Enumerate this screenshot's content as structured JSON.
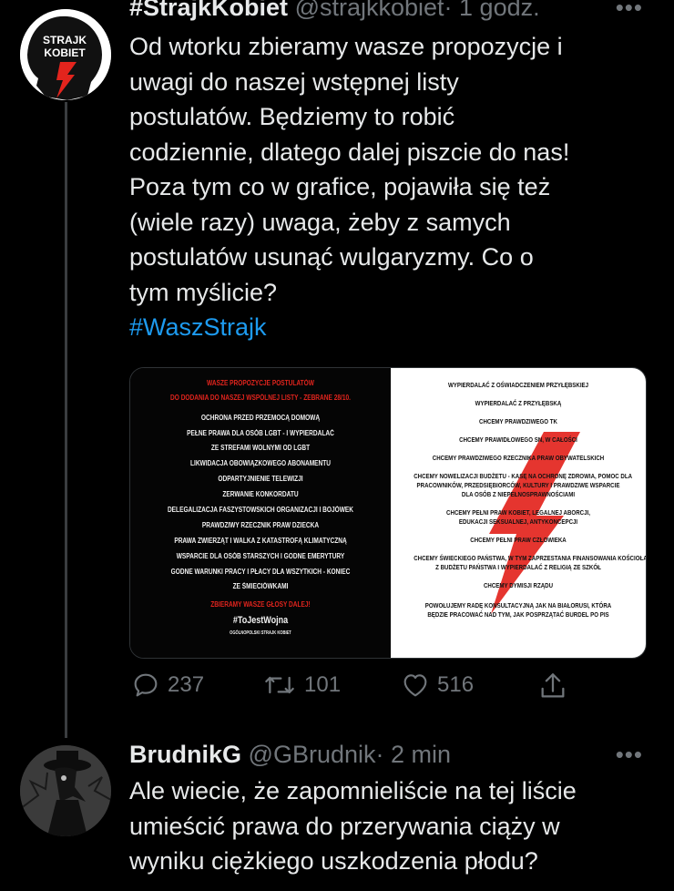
{
  "tweet1": {
    "name": "#StrajkKobiet",
    "handle": "@strajkkobiet",
    "time": "· 1 godz.",
    "more": "•••",
    "avatar_text": [
      "STRAJK",
      "KOBIET"
    ],
    "text_lines": [
      "Od wtorku zbieramy wasze propozycje i",
      "uwagi do naszej wstępnej listy",
      "postulatów. Będziemy to robić",
      "codziennie, dlatego dalej piszcie do nas!",
      "Poza tym co w grafice, pojawiła się też",
      "(wiele razy) uwaga, żeby z samych",
      "postulatów usunąć wulgaryzmy. Co o",
      "tym myślicie?"
    ],
    "hashtag": "#WaszStrajk",
    "media": {
      "left": [
        {
          "t": "WASZE PROPOZYCJE POSTULATÓW",
          "red": true
        },
        {
          "t": "DO DODANIA DO NASZEJ WSPÓLNEJ LISTY - ZEBRANE 28/10.",
          "red": true
        },
        {
          "t": "OCHRONA PRZED PRZEMOCĄ DOMOWĄ"
        },
        {
          "t": "PEŁNE PRAWA DLA OSÓB LGBT - I WYPIERDALAĆ"
        },
        {
          "t": "ZE STREFAMI WOLNYMI OD LGBT"
        },
        {
          "t": "LIKWIDACJA OBOWIĄZKOWEGO ABONAMENTU"
        },
        {
          "t": "ODPARTYJNIENIE TELEWIZJI"
        },
        {
          "t": "ZERWANIE KONKORDATU"
        },
        {
          "t": "DELEGALIZACJA FASZYSTOWSKICH ORGANIZACJI I BOJÓWEK"
        },
        {
          "t": "PRAWDZIWY RZECZNIK PRAW DZIECKA"
        },
        {
          "t": "PRAWA ZWIERZĄT I WALKA Z KATASTROFĄ KLIMATYCZNĄ"
        },
        {
          "t": "WSPARCIE DLA OSÓB STARSZYCH I GODNE EMERYTURY"
        },
        {
          "t": "GODNE WARUNKI PRACY I PŁACY DLA WSZYTKICH - KONIEC"
        },
        {
          "t": "ZE ŚMIECIÓWKAMI"
        },
        {
          "t": "ZBIERAMY WASZE GŁOSY DALEJ!",
          "red": true
        },
        {
          "t": "#ToJestWojna"
        },
        {
          "t": "OGÓLNOPOLSKI STRAJK KOBIET"
        }
      ],
      "right": [
        "WYPIERDALAĆ Z OŚWIADCZENIEM PRZYŁĘBSKIEJ",
        "WYPIERDALAĆ Z PRZYŁĘBSKĄ",
        "CHCEMY PRAWDZIWEGO TK",
        "CHCEMY PRAWIDŁOWEGO SN, W CAŁOŚCI",
        "CHCEMY PRAWDZIWEGO RZECZNIKA PRAW OBYWATELSKICH",
        "CHCEMY NOWELIZACJI BUDŻETU - KASĘ NA OCHRONĘ ZDROWIA, POMOC DLA",
        "PRACOWNIKÓW, PRZEDSIĘBIORCÓW, KULTURY I PRAWDZIWE WSPARCIE",
        "DLA OSÓB Z NIEPEŁNOSPRAWNOŚCIAMI",
        "CHCEMY PEŁNI PRAW KOBIET, LEGALNEJ ABORCJI,",
        "EDUKACJI SEKSUALNEJ, ANTYKONCEPCJI",
        "CHCEMY PEŁNI PRAW CZŁOWIEKA",
        "CHCEMY ŚWIECKIEGO PAŃSTWA, W TYM ZAPRZESTANIA FINANSOWANIA KOŚCIOŁA",
        "Z BUDŻETU PAŃSTWA I WYPIERDALAĆ Z RELIGIĄ ZE SZKÓŁ",
        "CHCEMY DYMISJI RZĄDU",
        "POWOŁUJEMY RADĘ KONSULTACYJNĄ JAK NA BIAŁORUSI, KTÓRA",
        "BĘDZIE PRACOWAĆ NAD TYM, JAK POSPRZĄTAĆ BURDEL PO PIS"
      ]
    },
    "actions": {
      "replies": "237",
      "retweets": "101",
      "likes": "516"
    }
  },
  "tweet2": {
    "name": "BrudnikG",
    "handle": "@GBrudnik",
    "time": "· 2 min",
    "more": "•••",
    "text_lines": [
      "Ale wiecie, że zapomnieliście na tej liście",
      "umieścić prawa do przerywania ciąży w",
      "wyniku ciężkiego uszkodzenia płodu?"
    ]
  },
  "colors": {
    "accent": "#1d9bf0",
    "secondary": "#71767b",
    "strike_red": "#e3241d"
  }
}
